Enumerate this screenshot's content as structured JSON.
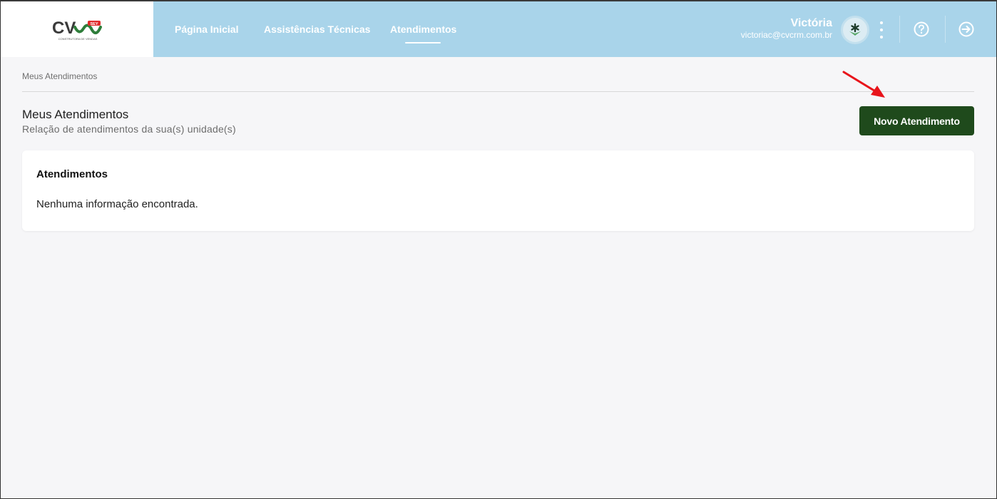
{
  "header": {
    "logo": {
      "text": "CV",
      "badge": "SEY",
      "tagline": "CONSTRUTORA DE VENDAS"
    },
    "nav": [
      {
        "label": "Página Inicial"
      },
      {
        "label": "Assistências Técnicas"
      },
      {
        "label": "Atendimentos",
        "active": true
      }
    ],
    "user": {
      "name": "Victória",
      "email": "victoriac@cvcrm.com.br",
      "avatar_icon": "asterisk-leaf-icon"
    },
    "actions": {
      "menu_icon": "kebab-menu-icon",
      "help_icon": "help-circle-icon",
      "logout_icon": "logout-icon"
    }
  },
  "breadcrumb": "Meus Atendimentos",
  "page": {
    "title": "Meus Atendimentos",
    "subtitle": "Relação de atendimentos da sua(s) unidade(s)",
    "new_button_label": "Novo Atendimento"
  },
  "card": {
    "title": "Atendimentos",
    "empty_message": "Nenhuma informação encontrada."
  },
  "colors": {
    "header_bg": "#a9d4ea",
    "primary_button": "#1f4a1c",
    "annotation_arrow": "#e8141b"
  }
}
